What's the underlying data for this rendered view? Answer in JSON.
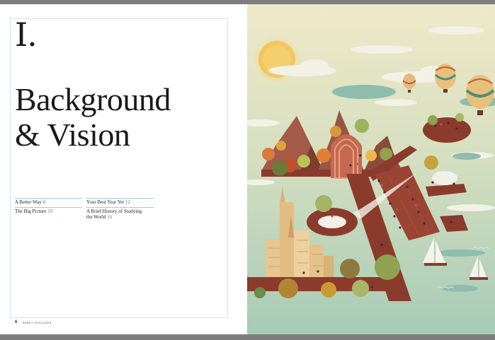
{
  "chapter": {
    "numeral": "I.",
    "title_line1": "Background",
    "title_line2": "& Vision"
  },
  "toc": [
    {
      "title": "A Better Way",
      "page": "8"
    },
    {
      "title": "Your Best Year Yet",
      "page": "12"
    },
    {
      "title": "The Big Picture",
      "page": "10"
    },
    {
      "title_line1": "A Brief History of Studying",
      "title_line2": "the World",
      "page": "16"
    }
  ],
  "footer": {
    "page_number": "6",
    "brand": "BARET SCHOLARS"
  },
  "colors": {
    "frame_rule": "#cfe3ee",
    "toc_rule": "#9ccbe0",
    "page_accent": "#2f8fbf",
    "sky_top": "#efe9c9",
    "sky_bottom": "#a6cbb6",
    "terracotta": "#8a3b2c"
  }
}
